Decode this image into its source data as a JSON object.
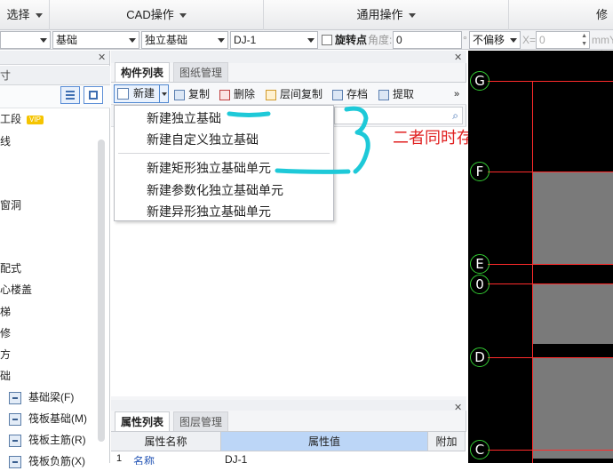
{
  "topbar": {
    "groups": [
      {
        "label": "选择"
      },
      {
        "label": "CAD操作"
      },
      {
        "label": "通用操作"
      },
      {
        "label": "修改"
      }
    ]
  },
  "proptoolbar": {
    "combo1": "",
    "combo2": "基础",
    "combo3": "独立基础",
    "combo4": "DJ-1",
    "rotate_point_label": "旋转点",
    "angle_label": "角度:",
    "angle_value": "0",
    "degree": "°",
    "offset_value": "不偏移",
    "x_label": "X=",
    "x_value": "0",
    "unit": "mm",
    "y_label": "Y"
  },
  "leftpanel": {
    "title_fragment": "寸",
    "items": [
      {
        "label": "工段",
        "badge": "VIP"
      },
      {
        "label": "线"
      },
      {
        "label": "窗洞"
      },
      {
        "label": "配式"
      },
      {
        "label": "心楼盖"
      },
      {
        "label": "梯"
      },
      {
        "label": "修"
      },
      {
        "label": "方"
      },
      {
        "label": "础"
      }
    ],
    "subitems": [
      {
        "label": "基础梁(F)"
      },
      {
        "label": "筏板基础(M)"
      },
      {
        "label": "筏板主筋(R)"
      },
      {
        "label": "筏板负筋(X)"
      }
    ]
  },
  "midpanel": {
    "tabs": [
      {
        "label": "构件列表"
      },
      {
        "label": "图纸管理"
      }
    ],
    "toolbar": {
      "new": "新建",
      "copy": "复制",
      "delete": "删除",
      "floor_copy": "层间复制",
      "save": "存档",
      "extract": "提取",
      "more": "»"
    },
    "prop_tabs": [
      {
        "label": "属性列表"
      },
      {
        "label": "图层管理"
      }
    ],
    "prop_table": {
      "headers": [
        "属性名称",
        "属性值",
        "附加"
      ],
      "rows": [
        {
          "num": "1",
          "name": "名称",
          "value": "DJ-1"
        }
      ]
    }
  },
  "dropdown": {
    "items": [
      "新建独立基础",
      "新建自定义独立基础",
      "新建矩形独立基础单元",
      "新建参数化独立基础单元",
      "新建异形独立基础单元"
    ]
  },
  "annotation": {
    "text": "二者同时存在",
    "color": "#e02020",
    "marker_color": "#1ec9d8"
  },
  "canvas": {
    "axes": [
      "G",
      "F",
      "E",
      "0",
      "D",
      "C"
    ]
  }
}
